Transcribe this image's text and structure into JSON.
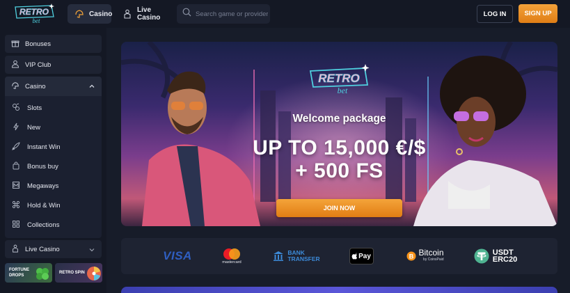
{
  "header": {
    "logo_top": "RETRO",
    "logo_bottom": "bet",
    "tabs": [
      {
        "label": "Casino",
        "icon": "casino-icon",
        "active": true
      },
      {
        "label": "Live Casino",
        "icon": "live-casino-icon",
        "active": false
      }
    ],
    "search": {
      "placeholder": "Search game or provider"
    },
    "login_label": "LOG IN",
    "signup_label": "SIGN UP"
  },
  "sidebar": {
    "items": [
      {
        "label": "Bonuses",
        "icon": "gift-icon"
      },
      {
        "label": "VIP Club",
        "icon": "user-icon"
      }
    ],
    "casino_group": {
      "label": "Casino",
      "icon": "casino-icon",
      "expanded": true,
      "subitems": [
        {
          "label": "Slots",
          "icon": "slots-icon"
        },
        {
          "label": "New",
          "icon": "lightning-icon"
        },
        {
          "label": "Instant Win",
          "icon": "rocket-icon"
        },
        {
          "label": "Bonus buy",
          "icon": "bag-icon"
        },
        {
          "label": "Megaways",
          "icon": "megaways-icon"
        },
        {
          "label": "Hold & Win",
          "icon": "hold-win-icon"
        },
        {
          "label": "Collections",
          "icon": "collections-icon"
        }
      ]
    },
    "live_casino": {
      "label": "Live Casino",
      "icon": "live-casino-icon",
      "expanded": false
    },
    "promos": [
      {
        "line1": "FORTUNE",
        "line2": "DROPS"
      },
      {
        "line1": "RETRO SPIN",
        "line2": ""
      }
    ]
  },
  "banner": {
    "logo_top": "RETRO",
    "logo_bottom": "bet",
    "welcome": "Welcome package",
    "offer_line1": "UP TO 15,000 €/$",
    "offer_line2": "+ 500 FS",
    "join_label": "JOIN NOW"
  },
  "payments": {
    "visa": "VISA",
    "mastercard": "mastercard",
    "bank_line1": "BANK",
    "bank_line2": "TRANSFER",
    "applepay": "Pay",
    "bitcoin": "Bitcoin",
    "bitcoin_sub": "by CoinsPaid",
    "usdt_line1": "USDT",
    "usdt_line2": "ERC20"
  },
  "colors": {
    "accent_orange": "#E88A22",
    "background": "#141824",
    "panel": "#1E2332",
    "usdt_green": "#4FB391",
    "bitcoin_orange": "#F7931A"
  }
}
